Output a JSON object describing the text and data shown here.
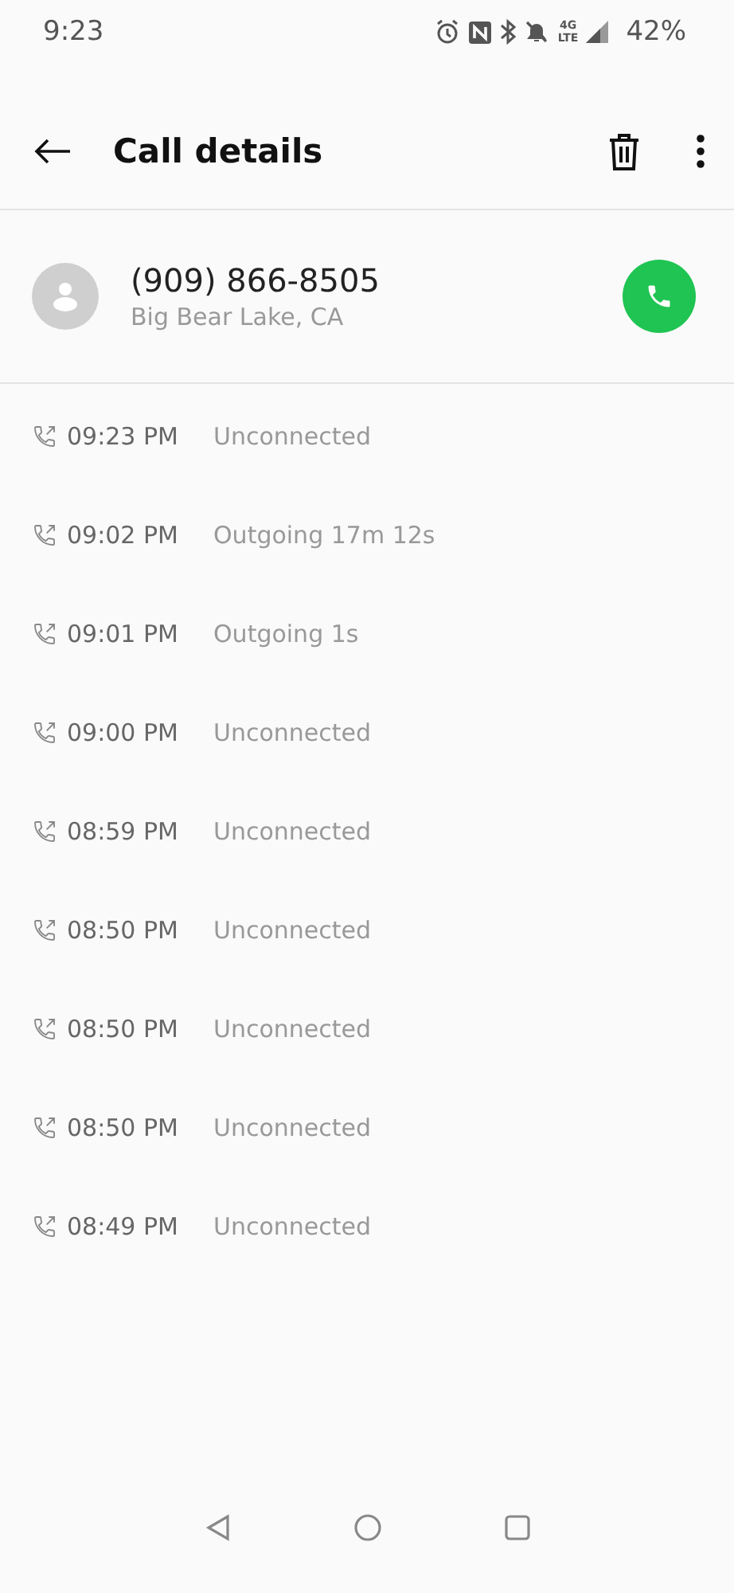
{
  "status_bar": {
    "time": "9:23",
    "network_top": "4G",
    "network_bottom": "LTE",
    "battery": "42%"
  },
  "toolbar": {
    "title": "Call details"
  },
  "contact": {
    "number": "(909) 866-8505",
    "location": "Big Bear Lake, CA"
  },
  "calls": [
    {
      "time": "09:23 PM",
      "detail": "Unconnected"
    },
    {
      "time": "09:02 PM",
      "detail": "Outgoing 17m 12s"
    },
    {
      "time": "09:01 PM",
      "detail": "Outgoing 1s"
    },
    {
      "time": "09:00 PM",
      "detail": "Unconnected"
    },
    {
      "time": "08:59 PM",
      "detail": "Unconnected"
    },
    {
      "time": "08:50 PM",
      "detail": "Unconnected"
    },
    {
      "time": "08:50 PM",
      "detail": "Unconnected"
    },
    {
      "time": "08:50 PM",
      "detail": "Unconnected"
    },
    {
      "time": "08:49 PM",
      "detail": "Unconnected"
    }
  ]
}
